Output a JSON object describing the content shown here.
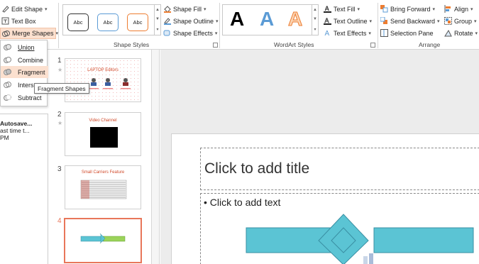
{
  "ribbon": {
    "insert_shapes": {
      "edit_shape": "Edit Shape",
      "text_box": "Text Box",
      "merge_shapes": "Merge Shapes"
    },
    "shape_styles": {
      "group_label": "Shape Styles",
      "swatches": [
        "Abc",
        "Abc",
        "Abc"
      ],
      "swatch_colors": [
        "#333333",
        "#5b9bd5",
        "#ed7d31"
      ],
      "shape_fill": "Shape Fill",
      "shape_outline": "Shape Outline",
      "shape_effects": "Shape Effects"
    },
    "wordart_styles": {
      "group_label": "WordArt Styles",
      "letters": [
        "A",
        "A",
        "A"
      ],
      "letter_colors": [
        "#000000",
        "#5b9bd5",
        "#f4b183"
      ],
      "text_fill": "Text Fill",
      "text_outline": "Text Outline",
      "text_effects": "Text Effects"
    },
    "arrange": {
      "group_label": "Arrange",
      "bring_forward": "Bring Forward",
      "send_backward": "Send Backward",
      "selection_pane": "Selection Pane",
      "align": "Align",
      "group": "Group",
      "rotate": "Rotate"
    }
  },
  "merge_menu": {
    "items": [
      "Union",
      "Combine",
      "Fragment",
      "Intersect",
      "Subtract"
    ],
    "highlighted": "Fragment",
    "tooltip": "Fragment Shapes"
  },
  "left_pane": {
    "title": "Autosave...",
    "line1": "ast time t...",
    "line2": "PM"
  },
  "thumbnails": [
    {
      "number": "1",
      "title": "LAPTOP Editors",
      "selected": false
    },
    {
      "number": "2",
      "title": "Video Channel",
      "selected": false
    },
    {
      "number": "3",
      "title": "Small Carriers Feature",
      "selected": false
    },
    {
      "number": "4",
      "title": "",
      "selected": true
    }
  ],
  "slide": {
    "title_placeholder": "Click to add title",
    "body_placeholder": "• Click to add text",
    "shape_color": "#5bc4d4",
    "shape_border": "#3a8fa3"
  },
  "colors": {
    "accent": "#e8765a",
    "highlight": "#fbe0cf"
  }
}
